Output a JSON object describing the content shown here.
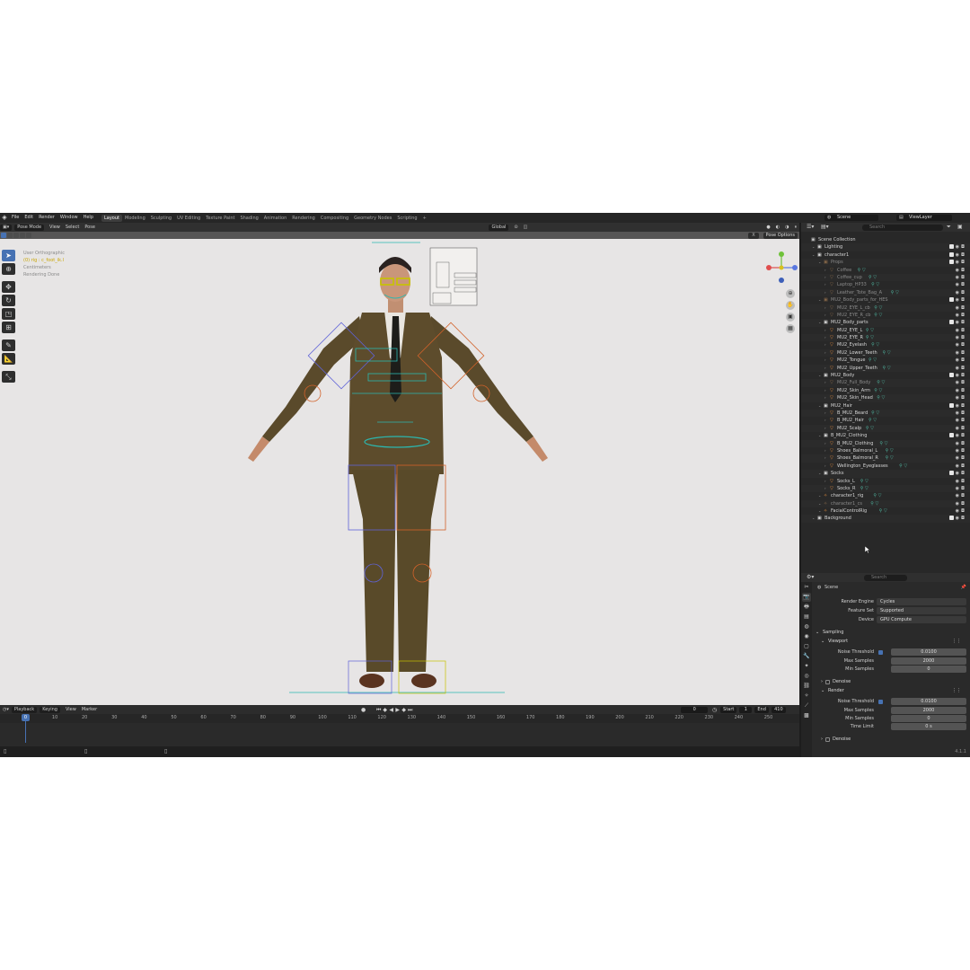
{
  "menu": {
    "items": [
      "File",
      "Edit",
      "Render",
      "Window",
      "Help"
    ]
  },
  "workspaces": [
    "Layout",
    "Modeling",
    "Sculpting",
    "UV Editing",
    "Texture Paint",
    "Shading",
    "Animation",
    "Rendering",
    "Compositing",
    "Geometry Nodes",
    "Scripting"
  ],
  "active_workspace": "Layout",
  "scene": "Scene",
  "view_layer": "ViewLayer",
  "viewport": {
    "mode": "Pose Mode",
    "menus": [
      "View",
      "Select",
      "Pose"
    ],
    "orientation": "Global",
    "pose_options": "Pose Options",
    "overlay_lines": [
      "User Orthographic",
      "(0) rig : c_foot_ik.l",
      "Centimeters",
      "Rendering Done"
    ]
  },
  "timeline": {
    "menus": [
      "Playback",
      "Keying",
      "View",
      "Marker"
    ],
    "current_frame": "0",
    "start_label": "Start",
    "start": "1",
    "end_label": "End",
    "end": "410",
    "ticks": [
      "10",
      "20",
      "30",
      "40",
      "50",
      "60",
      "70",
      "80",
      "90",
      "100",
      "110",
      "120",
      "130",
      "140",
      "150",
      "160",
      "170",
      "180",
      "190",
      "200",
      "210",
      "220",
      "230",
      "240",
      "250"
    ],
    "playhead": "0"
  },
  "outliner": {
    "search_placeholder": "Search",
    "rows": [
      {
        "name": "Scene Collection",
        "depth": 0,
        "type": "scene"
      },
      {
        "name": "Lighting",
        "depth": 1,
        "type": "col"
      },
      {
        "name": "character1",
        "depth": 1,
        "type": "col"
      },
      {
        "name": "Props",
        "depth": 2,
        "type": "col",
        "dim": true
      },
      {
        "name": "Coffee",
        "depth": 3,
        "type": "obj",
        "dim": true
      },
      {
        "name": "Coffee_cup",
        "depth": 3,
        "type": "obj",
        "dim": true
      },
      {
        "name": "Laptop_HP33",
        "depth": 3,
        "type": "obj",
        "dim": true
      },
      {
        "name": "Leather_Tote_Bag_A",
        "depth": 3,
        "type": "obj",
        "dim": true
      },
      {
        "name": "MU2_Body_parts_for_HES",
        "depth": 2,
        "type": "col",
        "dim": true
      },
      {
        "name": "MU2_EYE_L_cb",
        "depth": 3,
        "type": "obj",
        "dim": true
      },
      {
        "name": "MU2_EYE_R_cb",
        "depth": 3,
        "type": "obj",
        "dim": true
      },
      {
        "name": "MU2_Body_parts",
        "depth": 2,
        "type": "col"
      },
      {
        "name": "MU2_EYE_L",
        "depth": 3,
        "type": "obj"
      },
      {
        "name": "MU2_EYE_R",
        "depth": 3,
        "type": "obj"
      },
      {
        "name": "MU2_Eyelash",
        "depth": 3,
        "type": "obj"
      },
      {
        "name": "MU2_Lower_Teeth",
        "depth": 3,
        "type": "obj"
      },
      {
        "name": "MU2_Tongue",
        "depth": 3,
        "type": "obj"
      },
      {
        "name": "MU2_Upper_Teeth",
        "depth": 3,
        "type": "obj"
      },
      {
        "name": "MU2_Body",
        "depth": 2,
        "type": "col"
      },
      {
        "name": "MU2_Full_Body",
        "depth": 3,
        "type": "obj",
        "dim": true
      },
      {
        "name": "MU2_Skin_Arm",
        "depth": 3,
        "type": "obj"
      },
      {
        "name": "MU2_Skin_Head",
        "depth": 3,
        "type": "obj"
      },
      {
        "name": "MU2_Hair",
        "depth": 2,
        "type": "col"
      },
      {
        "name": "B_MU2_Beard",
        "depth": 3,
        "type": "obj"
      },
      {
        "name": "B_MU2_Hair",
        "depth": 3,
        "type": "obj"
      },
      {
        "name": "MU2_Scalp",
        "depth": 3,
        "type": "obj"
      },
      {
        "name": "B_MU2_Clothing",
        "depth": 2,
        "type": "col"
      },
      {
        "name": "B_MU2_Clothing",
        "depth": 3,
        "type": "obj"
      },
      {
        "name": "Shoes_Balmoral_L",
        "depth": 3,
        "type": "obj"
      },
      {
        "name": "Shoes_Balmoral_R",
        "depth": 3,
        "type": "obj"
      },
      {
        "name": "Wellington_Eyeglasses",
        "depth": 3,
        "type": "obj"
      },
      {
        "name": "Socks",
        "depth": 2,
        "type": "col"
      },
      {
        "name": "Socks_L",
        "depth": 3,
        "type": "obj"
      },
      {
        "name": "Socks_R",
        "depth": 3,
        "type": "obj"
      },
      {
        "name": "character1_rig",
        "depth": 2,
        "type": "rig"
      },
      {
        "name": "character1_cs",
        "depth": 2,
        "type": "rig",
        "dim": true
      },
      {
        "name": "FacialControlRig",
        "depth": 2,
        "type": "rig"
      },
      {
        "name": "Background",
        "depth": 1,
        "type": "col"
      }
    ]
  },
  "properties": {
    "search_placeholder": "Search",
    "context": "Scene",
    "render_engine_label": "Render Engine",
    "render_engine": "Cycles",
    "feature_set_label": "Feature Set",
    "feature_set": "Supported",
    "device_label": "Device",
    "device": "GPU Compute",
    "sampling": "Sampling",
    "viewport_section": "Viewport",
    "render_section": "Render",
    "denoise": "Denoise",
    "noise_threshold_label": "Noise Threshold",
    "max_samples_label": "Max Samples",
    "min_samples_label": "Min Samples",
    "time_limit_label": "Time Limit",
    "vp_noise_threshold": "0.0100",
    "vp_max_samples": "2000",
    "vp_min_samples": "0",
    "r_noise_threshold": "0.0100",
    "r_max_samples": "2000",
    "r_min_samples": "0",
    "r_time_limit": "0 s"
  },
  "version": "4.1.1",
  "colors": {
    "accent": "#4772b3",
    "viewport_bg": "#e7e5e5",
    "suit": "#5b4a2a",
    "rig_blue": "#5f63d8",
    "rig_orange": "#d2622a",
    "rig_cyan": "#2bb8b0"
  }
}
